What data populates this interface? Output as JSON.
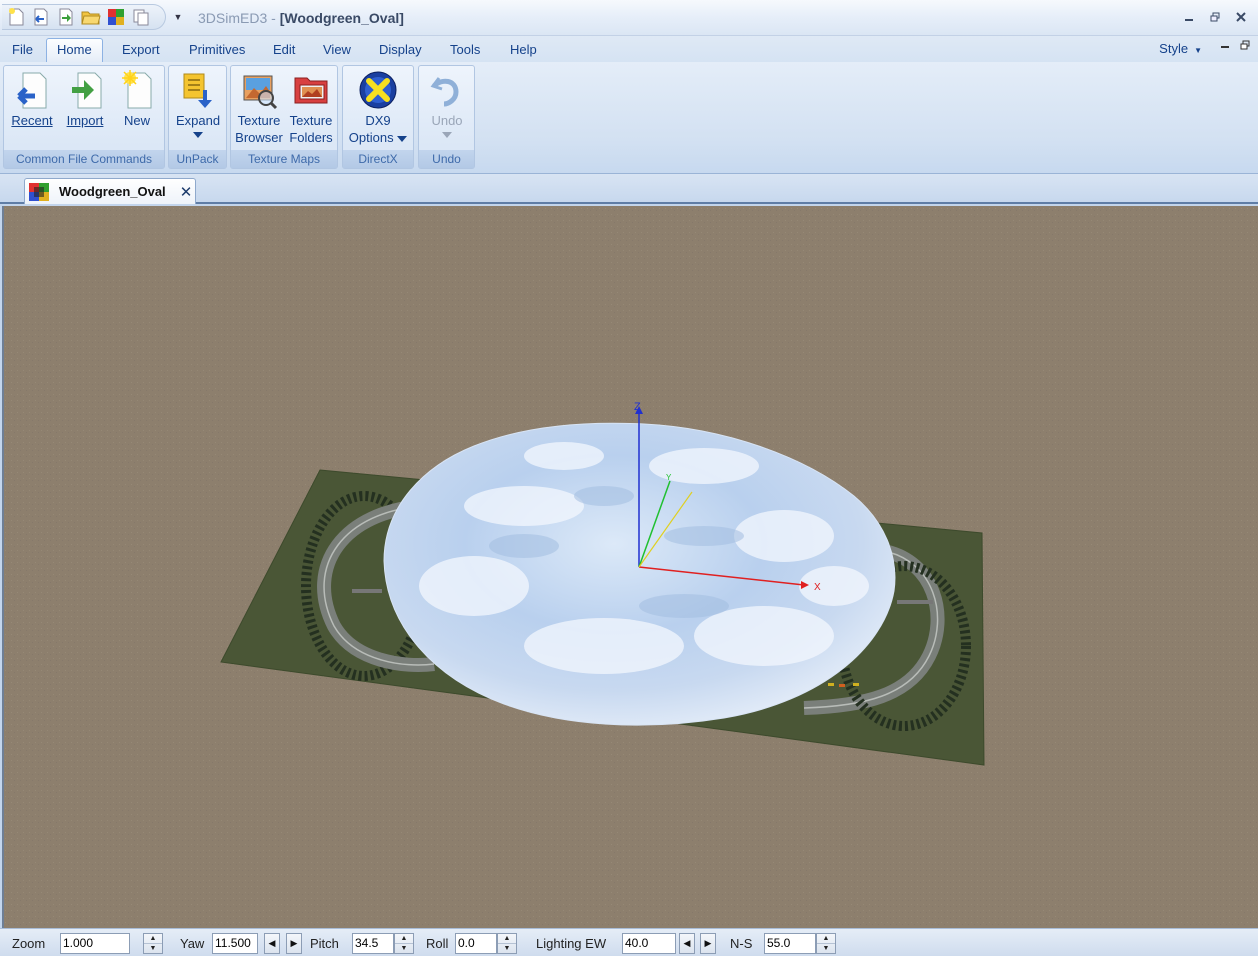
{
  "window": {
    "app_name": "3DSimED3",
    "separator": " - ",
    "document_title": "[Woodgreen_Oval]"
  },
  "menu": {
    "items": [
      "File",
      "Home",
      "Export",
      "Primitives",
      "Edit",
      "View",
      "Display",
      "Tools",
      "Help"
    ],
    "active": "Home",
    "style_label": "Style"
  },
  "ribbon": {
    "groups": {
      "common_file": {
        "label": "Common File Commands",
        "recent": "Recent",
        "import": "Import",
        "new": "New"
      },
      "unpack": {
        "label": "UnPack",
        "expand": "Expand"
      },
      "texture_maps": {
        "label": "Texture Maps",
        "browser_line1": "Texture",
        "browser_line2": "Browser",
        "folders_line1": "Texture",
        "folders_line2": "Folders"
      },
      "directx": {
        "label": "DirectX",
        "dx9_line1": "DX9",
        "dx9_line2": "Options"
      },
      "undo": {
        "label": "Undo",
        "undo": "Undo"
      }
    }
  },
  "document_tab": {
    "label": "Woodgreen_Oval"
  },
  "viewport": {
    "axis_z": "Z",
    "axis_x": "X",
    "axis_y": "Y",
    "background_color": "#8d7f6d",
    "ground_color": "#4a5636",
    "axis_colors": {
      "x": "#e02020",
      "y": "#20c030",
      "z": "#2030d0"
    }
  },
  "statusbar": {
    "zoom_label": "Zoom",
    "zoom_value": "1.000",
    "yaw_label": "Yaw",
    "yaw_value": "11.500",
    "pitch_label": "Pitch",
    "pitch_value": "34.5",
    "roll_label": "Roll",
    "roll_value": "0.0",
    "lighting_label": "Lighting EW",
    "lighting_value": "40.0",
    "ns_label": "N-S",
    "ns_value": "55.0"
  }
}
